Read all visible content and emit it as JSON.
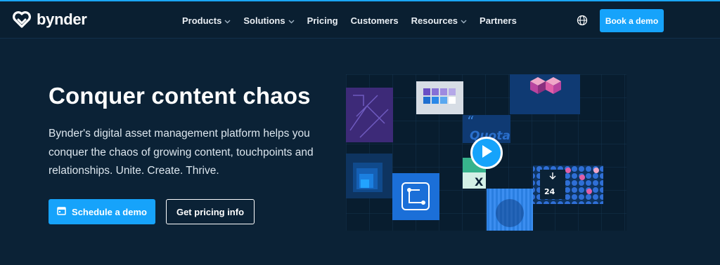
{
  "brand": {
    "name": "bynder",
    "accent": "#16a3fb",
    "background": "#0b2236"
  },
  "nav": {
    "items": [
      {
        "label": "Products",
        "has_dropdown": true
      },
      {
        "label": "Solutions",
        "has_dropdown": true
      },
      {
        "label": "Pricing",
        "has_dropdown": false
      },
      {
        "label": "Customers",
        "has_dropdown": false
      },
      {
        "label": "Resources",
        "has_dropdown": true
      },
      {
        "label": "Partners",
        "has_dropdown": false
      }
    ],
    "globe_icon": "globe-icon",
    "book_demo_label": "Book a demo"
  },
  "hero": {
    "title": "Conquer content chaos",
    "description": "Bynder's digital asset management platform helps you conquer the chaos of growing content, touchpoints and relationships. Unite. Create. Thrive.",
    "primary_cta": {
      "label": "Schedule a demo",
      "icon": "calendar-icon"
    },
    "secondary_cta": {
      "label": "Get pricing info"
    },
    "media": {
      "quote_text": "Quota",
      "badge_number": "24",
      "spreadsheet_letter": "X",
      "play_icon": "play-icon"
    }
  }
}
